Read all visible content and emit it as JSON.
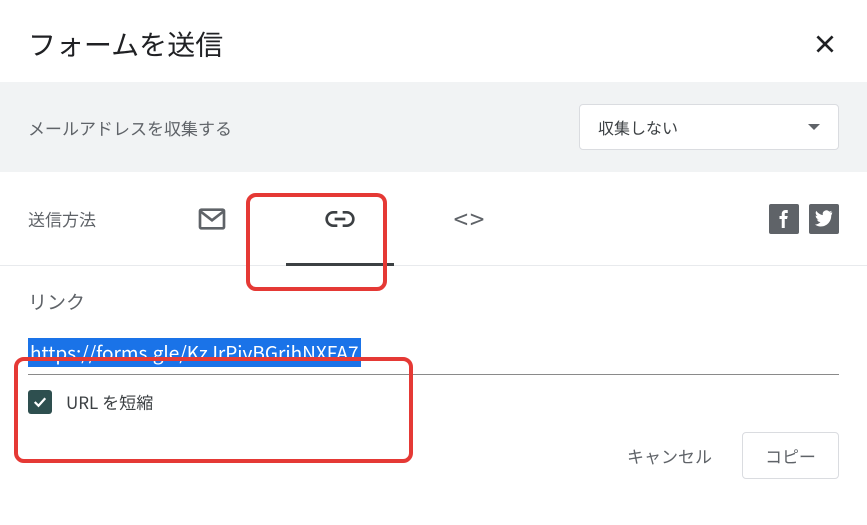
{
  "header": {
    "title": "フォームを送信"
  },
  "emailCollect": {
    "label": "メールアドレスを収集する",
    "selected": "収集しない"
  },
  "sendMethod": {
    "label": "送信方法"
  },
  "linkSection": {
    "title": "リンク",
    "url": "https://forms.gle/KzJrPivBGrihNXFA7",
    "shortenLabel": "URL を短縮"
  },
  "footer": {
    "cancel": "キャンセル",
    "copy": "コピー"
  }
}
